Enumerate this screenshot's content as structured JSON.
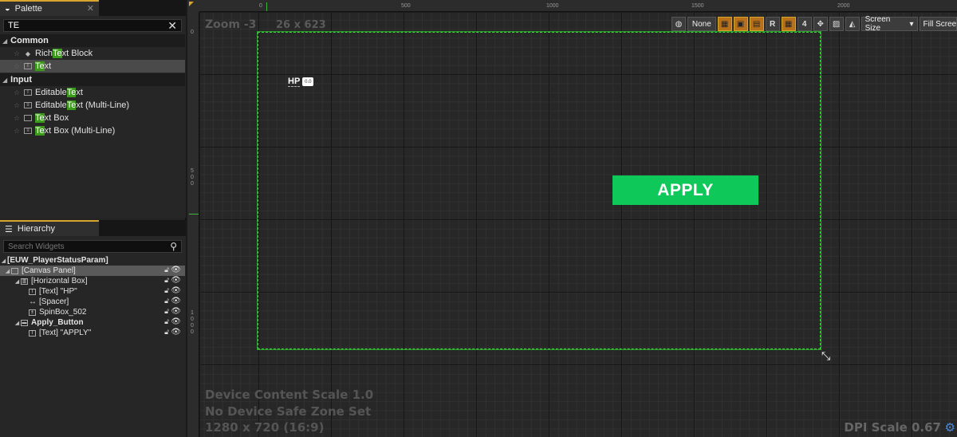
{
  "palette": {
    "tab_label": "Palette",
    "search_value": "TE",
    "categories": [
      {
        "label": "Common",
        "items": [
          {
            "pre": "Rich ",
            "hl": "Te",
            "post": "xt Block",
            "icon": "diamond-icon"
          },
          {
            "pre": "",
            "hl": "Te",
            "post": "xt",
            "icon": "text-icon",
            "selected": true
          }
        ]
      },
      {
        "label": "Input",
        "items": [
          {
            "pre": "Editable ",
            "hl": "Te",
            "post": "xt",
            "icon": "editable-text-icon"
          },
          {
            "pre": "Editable ",
            "hl": "Te",
            "post": "xt (Multi-Line)",
            "icon": "multiline-icon"
          },
          {
            "pre": "",
            "hl": "Te",
            "post": "xt Box",
            "icon": "textbox-icon"
          },
          {
            "pre": "",
            "hl": "Te",
            "post": "xt Box (Multi-Line)",
            "icon": "textbox-multiline-icon"
          }
        ]
      }
    ]
  },
  "hierarchy": {
    "tab_label": "Hierarchy",
    "search_placeholder": "Search Widgets",
    "root": "[EUW_PlayerStatusParam]",
    "rows": [
      {
        "label": "[Canvas Panel]",
        "selected": true
      },
      {
        "label": "[Horizontal Box]"
      },
      {
        "label": "[Text] \"HP\""
      },
      {
        "label": "[Spacer]"
      },
      {
        "label": "SpinBox_502"
      },
      {
        "label": "Apply_Button",
        "bold": true
      },
      {
        "label": "[Text] \"APPLY\""
      }
    ]
  },
  "designer": {
    "zoom": "Zoom -3",
    "size": "26 x 623",
    "ruler_top": [
      "0",
      "500",
      "1000",
      "1500",
      "2000"
    ],
    "ruler_left": [
      "0",
      "500",
      "1000"
    ],
    "toolbar": {
      "none_label": "None",
      "r_label": "R",
      "num_label": "4",
      "screen_size_label": "Screen Size",
      "fill_screen_label": "Fill Screen"
    },
    "hp_label": "HP",
    "spin_value": "0.0",
    "apply_label": "APPLY",
    "device_content_scale": "Device Content Scale 1.0",
    "safe_zone": "No Device Safe Zone Set",
    "resolution": "1280 x 720 (16:9)",
    "dpi_scale": "DPI Scale 0.67"
  },
  "colors": {
    "accent": "#d7a42c",
    "apply_button": "#0fc85a",
    "canvas_border": "#3ddc3d",
    "highlight": "#3c9a1a"
  }
}
